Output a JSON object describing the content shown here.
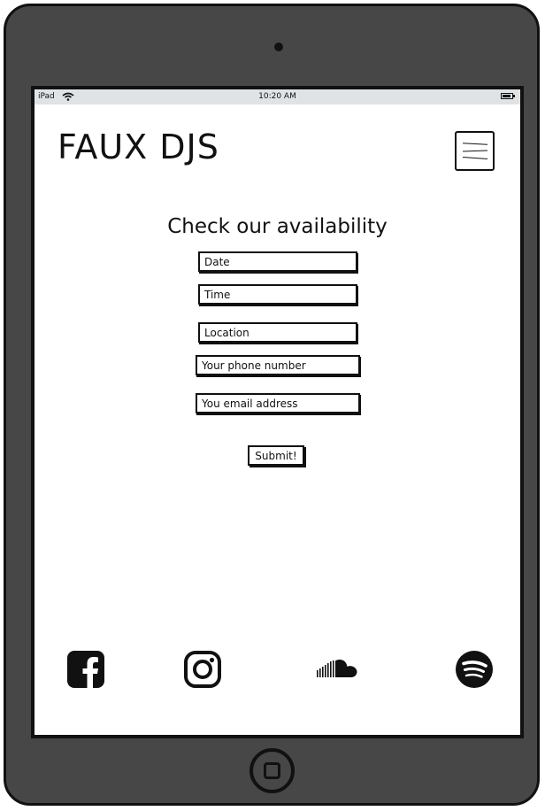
{
  "status_bar": {
    "device": "iPad",
    "time": "10:20 AM"
  },
  "header": {
    "brand": "FAUX DJS",
    "menu_icon": "hamburger-menu-icon"
  },
  "form": {
    "heading": "Check our availability",
    "fields": [
      {
        "placeholder": "Date",
        "value": ""
      },
      {
        "placeholder": "Time",
        "value": ""
      },
      {
        "placeholder": "Location",
        "value": ""
      },
      {
        "placeholder": "Your phone number",
        "value": ""
      },
      {
        "placeholder": "You email address",
        "value": ""
      }
    ],
    "submit_label": "Submit!"
  },
  "social_icons": [
    "facebook-icon",
    "instagram-icon",
    "soundcloud-icon",
    "spotify-icon"
  ],
  "colors": {
    "device_body": "#474747",
    "status_bar": "#dfe3e6",
    "ink": "#111111",
    "screen": "#ffffff"
  }
}
